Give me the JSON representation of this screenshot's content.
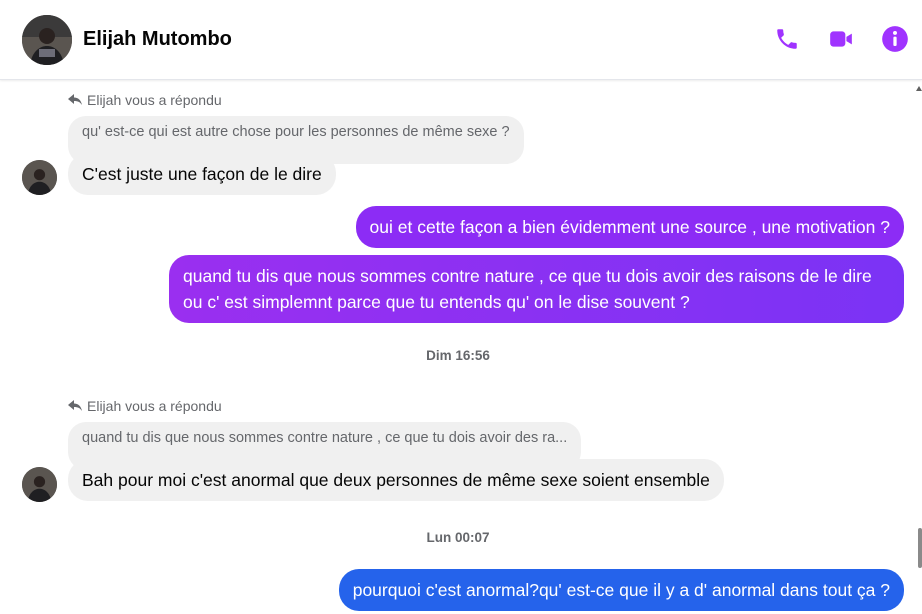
{
  "header": {
    "contact_name": "Elijah Mutombo",
    "actions": [
      {
        "icon": "phone-icon"
      },
      {
        "icon": "video-camera-icon"
      },
      {
        "icon": "info-icon"
      }
    ],
    "accent_color": "#a033ff"
  },
  "messages": {
    "reply1": {
      "note": "Elijah vous a répondu",
      "quoted": "qu' est-ce qui est autre chose pour les personnes de même sexe ?",
      "text": "C'est juste une façon de le dire"
    },
    "out1": "oui et cette façon a bien évidemment une source , une motivation ?",
    "out2": "quand tu dis que nous sommes contre nature , ce que tu dois avoir des raisons de le dire ou c' est simplemnt parce que tu entends qu' on le dise souvent ?",
    "timestamp1": "Dim 16:56",
    "reply2": {
      "note": "Elijah vous a répondu",
      "quoted": "quand tu dis que nous sommes contre nature , ce que tu dois avoir des ra...",
      "text": "Bah pour moi c'est anormal que deux personnes de même sexe soient ensemble"
    },
    "timestamp2": "Lun 00:07",
    "out3": "pourquoi c'est anormal?qu' est-ce que il y a d' anormal dans tout ça ?"
  },
  "colors": {
    "outgoing_purple": "#8c2cf5",
    "outgoing_blue": "#2563eb",
    "incoming_bg": "#f0f0f0"
  }
}
